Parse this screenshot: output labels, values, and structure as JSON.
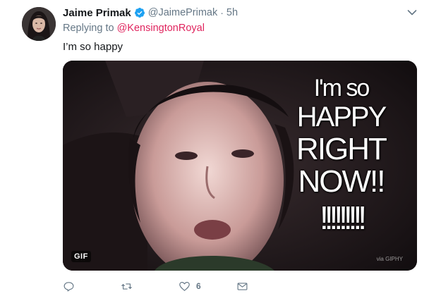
{
  "user": {
    "display_name": "Jaime Primak",
    "handle": "@JaimePrimak",
    "separator": "·",
    "time": "5h",
    "verified": true
  },
  "reply": {
    "prefix": "Replying to ",
    "to": "@KensingtonRoyal"
  },
  "text": "I’m so happy",
  "media": {
    "type": "gif",
    "badge": "GIF",
    "overlay_lines": [
      "I'm so",
      "HAPPY",
      "RIGHT",
      "NOW!!",
      "!!!!!!!!!"
    ],
    "watermark": "via GIPHY"
  },
  "actions": {
    "reply": {
      "icon": "reply-icon",
      "count": ""
    },
    "retweet": {
      "icon": "retweet-icon",
      "count": ""
    },
    "like": {
      "icon": "heart-icon",
      "count": "6"
    },
    "dm": {
      "icon": "envelope-icon",
      "count": ""
    }
  },
  "colors": {
    "text": "#14171a",
    "secondary": "#657786",
    "mention": "#e0245e",
    "verified": "#1da1f2"
  }
}
